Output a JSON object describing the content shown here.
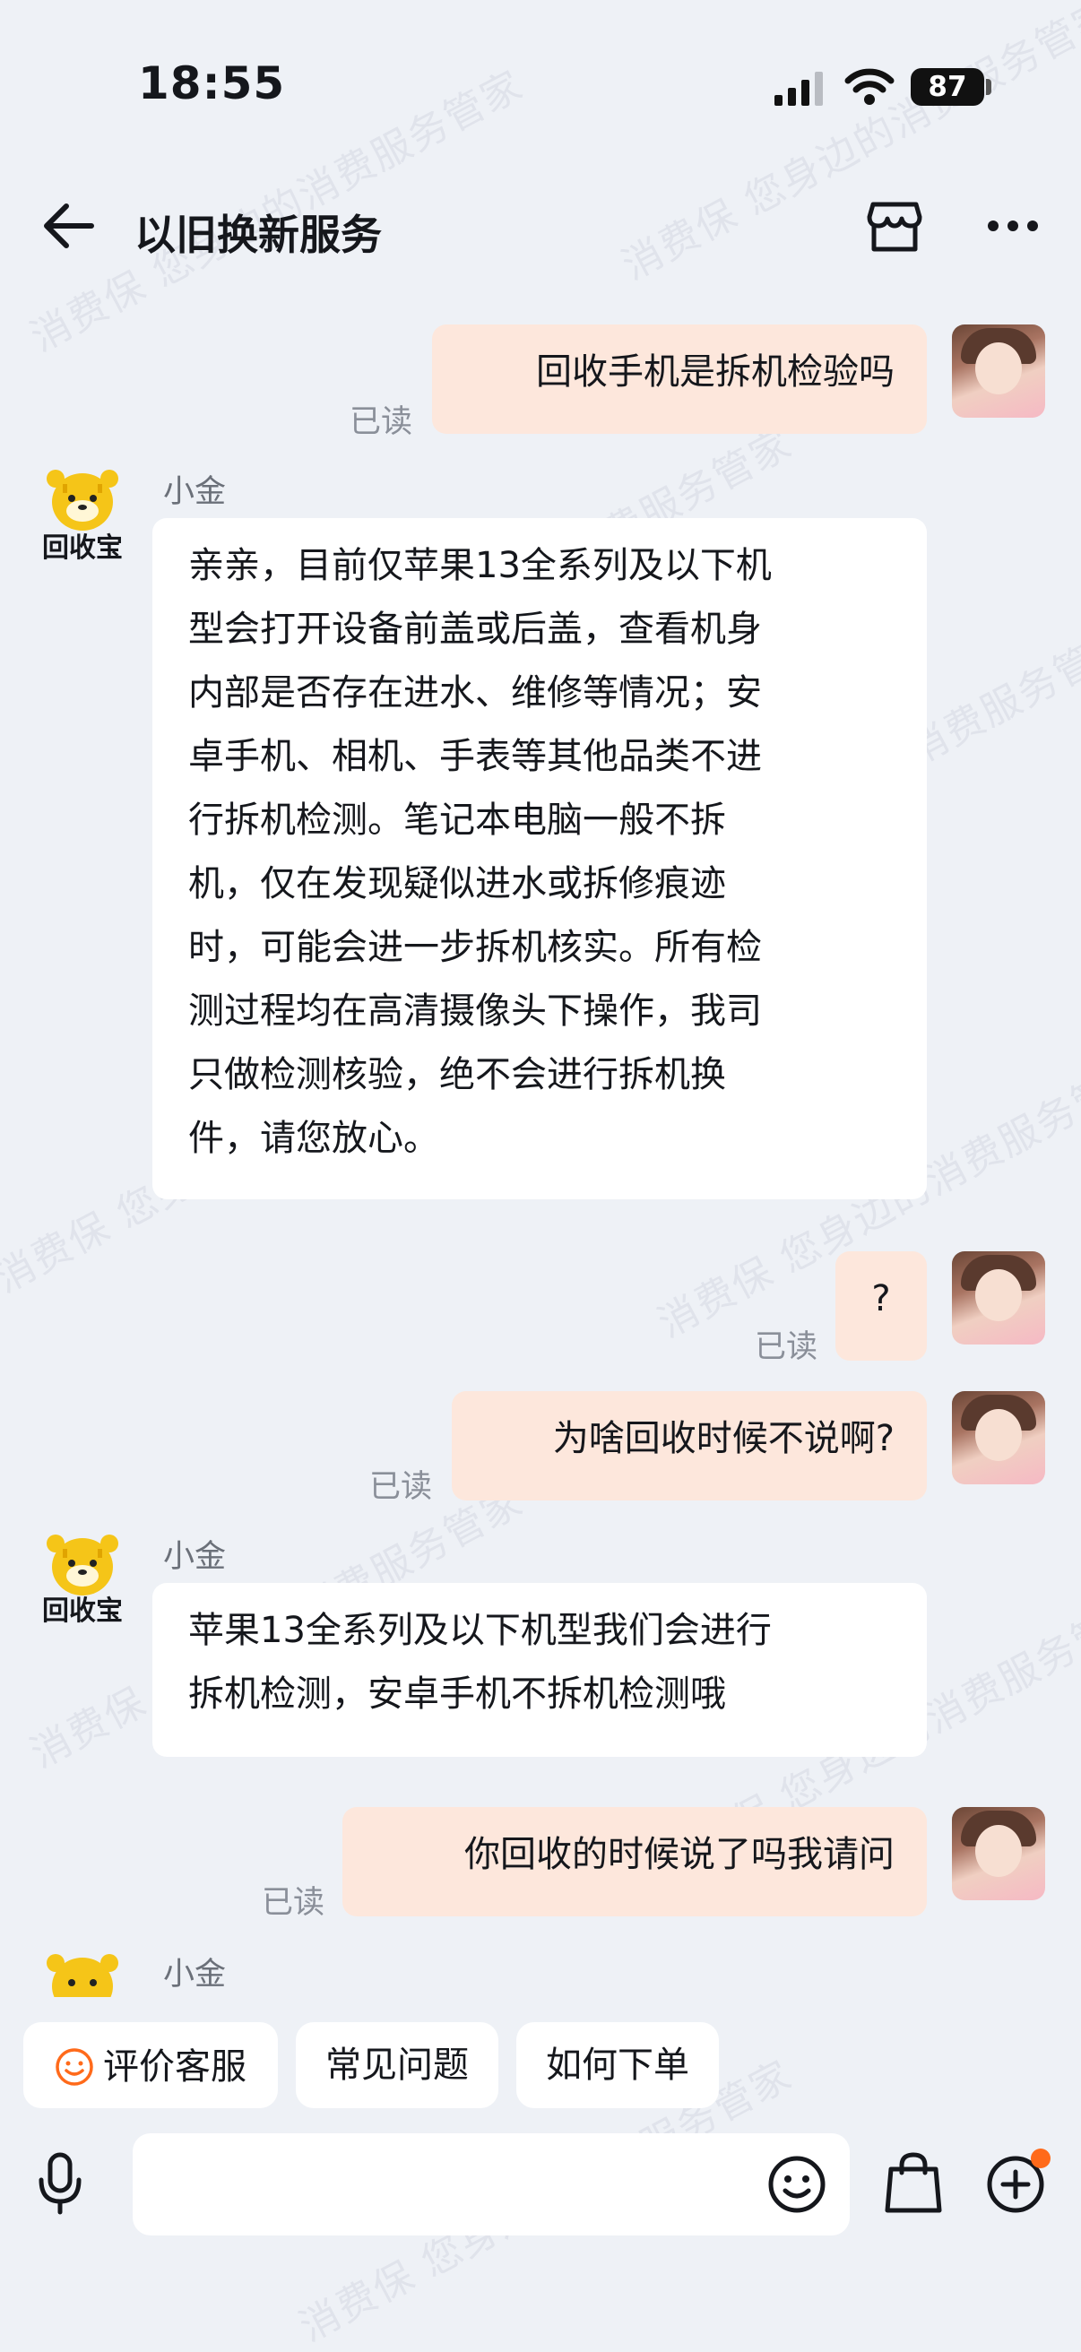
{
  "status_bar": {
    "time": "18:55",
    "battery": "87"
  },
  "header": {
    "title": "以旧换新服务"
  },
  "brand": {
    "bot_badge": "回收宝"
  },
  "watermark": {
    "text": "消费保 您身边的消费服务管家"
  },
  "messages": [
    {
      "from": "user",
      "text": "回收手机是拆机检验吗",
      "status": "已读"
    },
    {
      "from": "bot",
      "sender": "小金",
      "lines": [
        "亲亲，目前仅苹果13全系列及以下机",
        "型会打开设备前盖或后盖，查看机身",
        "内部是否存在进水、维修等情况；安",
        "卓手机、相机、手表等其他品类不进",
        "行拆机检测。笔记本电脑一般不拆",
        "机，仅在发现疑似进水或拆修痕迹",
        "时，可能会进一步拆机核实。所有检",
        "测过程均在高清摄像头下操作，我司",
        "只做检测核验，绝不会进行拆机换",
        "件，请您放心。"
      ]
    },
    {
      "from": "user",
      "text": "?",
      "status": "已读"
    },
    {
      "from": "user",
      "text": "为啥回收时候不说啊?",
      "status": "已读"
    },
    {
      "from": "bot",
      "sender": "小金",
      "lines": [
        "苹果13全系列及以下机型我们会进行",
        "拆机检测，安卓手机不拆机检测哦"
      ]
    },
    {
      "from": "user",
      "text": "你回收的时候说了吗我请问",
      "status": "已读"
    },
    {
      "from": "bot",
      "sender": "小金",
      "lines": []
    }
  ],
  "quick_replies": [
    "评价客服",
    "常见问题",
    "如何下单"
  ],
  "colors": {
    "accent": "#ff6a1a",
    "user_bubble": "#fde7dc",
    "bot_bubble": "#ffffff",
    "background": "#eef1f6",
    "bot_yellow": "#f5c518"
  },
  "icons": [
    "back-arrow-icon",
    "store-icon",
    "more-icon",
    "voice-icon",
    "emoji-icon",
    "bag-icon",
    "plus-icon",
    "smile-icon"
  ]
}
